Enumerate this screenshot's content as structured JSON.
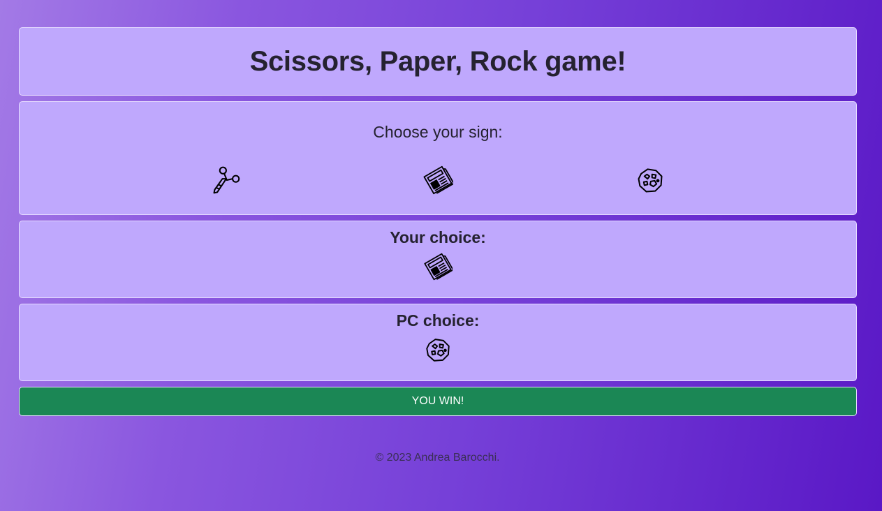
{
  "header": {
    "title": "Scissors, Paper, Rock game!"
  },
  "choose": {
    "prompt": "Choose your sign:",
    "options": [
      {
        "name": "Scissors",
        "icon": "scissors-icon"
      },
      {
        "name": "Paper",
        "icon": "newspaper-icon"
      },
      {
        "name": "Rock",
        "icon": "rock-icon"
      }
    ]
  },
  "your_choice": {
    "label": "Your choice:",
    "icon": "newspaper-icon"
  },
  "pc_choice": {
    "label": "PC choice:",
    "icon": "rock-icon"
  },
  "result": {
    "text": "YOU WIN!",
    "color": "#1b8755"
  },
  "footer": {
    "text": "© 2023 Andrea Barocchi."
  },
  "theme": {
    "card_bg": "#bfa8fd",
    "gradient_start": "#a37ae6",
    "gradient_end": "#5a18c6"
  }
}
